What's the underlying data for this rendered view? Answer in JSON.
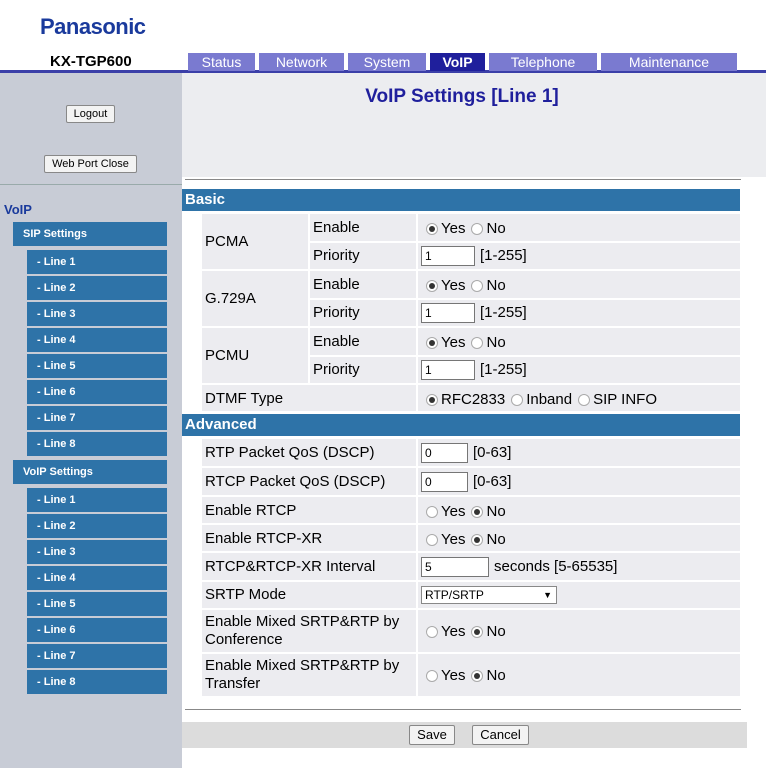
{
  "header": {
    "brand": "Panasonic",
    "model": "KX-TGP600",
    "tabs": [
      {
        "label": "Status"
      },
      {
        "label": "Network"
      },
      {
        "label": "System"
      },
      {
        "label": "VoIP",
        "active": true
      },
      {
        "label": "Telephone"
      },
      {
        "label": "Maintenance"
      }
    ]
  },
  "sidebar": {
    "logout_label": "Logout",
    "web_port_close_label": "Web Port Close",
    "section_title": "VoIP",
    "sip_settings_label": "SIP Settings",
    "sip_lines": [
      "- Line 1",
      "- Line 2",
      "- Line 3",
      "- Line 4",
      "- Line 5",
      "- Line 6",
      "- Line 7",
      "- Line 8"
    ],
    "voip_settings_label": "VoIP Settings",
    "voip_lines": [
      "- Line 1",
      "- Line 2",
      "- Line 3",
      "- Line 4",
      "- Line 5",
      "- Line 6",
      "- Line 7",
      "- Line 8"
    ]
  },
  "main": {
    "title": "VoIP Settings [Line 1]",
    "basic": {
      "title": "Basic",
      "enable_label": "Enable",
      "priority_label": "Priority",
      "yes_label": "Yes",
      "no_label": "No",
      "priority_range": "[1-255]",
      "codecs": [
        {
          "name": "PCMA",
          "enable": "Yes",
          "priority": "1"
        },
        {
          "name": "G.729A",
          "enable": "Yes",
          "priority": "1"
        },
        {
          "name": "PCMU",
          "enable": "Yes",
          "priority": "1"
        }
      ],
      "dtmf": {
        "label": "DTMF Type",
        "options": [
          "RFC2833",
          "Inband",
          "SIP INFO"
        ],
        "selected": "RFC2833"
      }
    },
    "advanced": {
      "title": "Advanced",
      "rtp_qos": {
        "label": "RTP Packet QoS (DSCP)",
        "value": "0",
        "range": "[0-63]"
      },
      "rtcp_qos": {
        "label": "RTCP Packet QoS (DSCP)",
        "value": "0",
        "range": "[0-63]"
      },
      "enable_rtcp": {
        "label": "Enable RTCP",
        "selected": "No"
      },
      "enable_rtcp_xr": {
        "label": "Enable RTCP-XR",
        "selected": "No"
      },
      "interval": {
        "label": "RTCP&RTCP-XR Interval",
        "value": "5",
        "range": "seconds [5-65535]"
      },
      "srtp_mode": {
        "label": "SRTP Mode",
        "value": "RTP/SRTP"
      },
      "mixed_conf": {
        "label_1": "Enable Mixed SRTP&RTP by",
        "label_2": "Conference",
        "selected": "No"
      },
      "mixed_transfer": {
        "label_1": "Enable Mixed SRTP&RTP by",
        "label_2": "Transfer",
        "selected": "No"
      }
    },
    "save_label": "Save",
    "cancel_label": "Cancel"
  }
}
